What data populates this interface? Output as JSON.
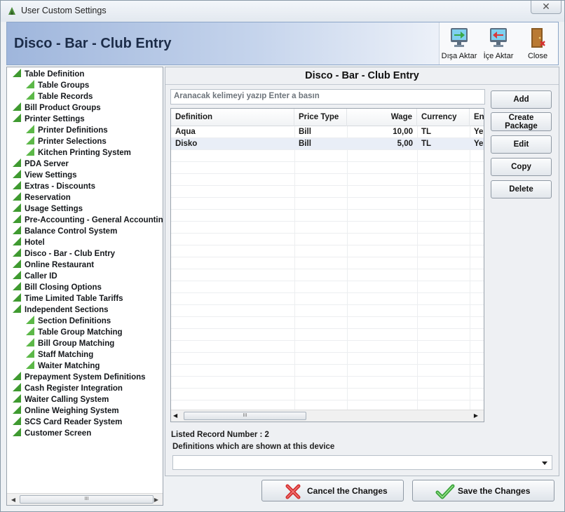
{
  "window": {
    "title": "User Custom Settings",
    "close_glyph": "✕"
  },
  "banner": {
    "title": "Disco - Bar - Club Entry"
  },
  "toolbar": [
    {
      "label": "Dışa Aktar",
      "icon": "export-monitor-icon"
    },
    {
      "label": "İçe Aktar",
      "icon": "import-monitor-icon"
    },
    {
      "label": "Close",
      "icon": "exit-door-icon"
    }
  ],
  "tree": {
    "items": [
      {
        "label": "Table Definition",
        "level": 0
      },
      {
        "label": "Table Groups",
        "level": 1
      },
      {
        "label": "Table Records",
        "level": 1
      },
      {
        "label": "Bill Product Groups",
        "level": 0
      },
      {
        "label": "Printer Settings",
        "level": 0
      },
      {
        "label": "Printer Definitions",
        "level": 1
      },
      {
        "label": "Printer Selections",
        "level": 1
      },
      {
        "label": "Kitchen Printing System",
        "level": 1
      },
      {
        "label": "PDA Server",
        "level": 0
      },
      {
        "label": "View Settings",
        "level": 0
      },
      {
        "label": "Extras - Discounts",
        "level": 0
      },
      {
        "label": "Reservation",
        "level": 0
      },
      {
        "label": "Usage Settings",
        "level": 0
      },
      {
        "label": "Pre-Accounting - General Accountin",
        "level": 0
      },
      {
        "label": "Balance Control System",
        "level": 0
      },
      {
        "label": "Hotel",
        "level": 0
      },
      {
        "label": "Disco - Bar - Club Entry",
        "level": 0
      },
      {
        "label": "Online Restaurant",
        "level": 0
      },
      {
        "label": "Caller ID",
        "level": 0
      },
      {
        "label": "Bill Closing Options",
        "level": 0
      },
      {
        "label": "Time Limited Table Tariffs",
        "level": 0
      },
      {
        "label": "Independent Sections",
        "level": 0
      },
      {
        "label": "Section Definitions",
        "level": 1
      },
      {
        "label": "Table Group Matching",
        "level": 1
      },
      {
        "label": "Bill Group Matching",
        "level": 1
      },
      {
        "label": "Staff Matching",
        "level": 1
      },
      {
        "label": "Waiter Matching",
        "level": 1
      },
      {
        "label": "Prepayment System Definitions",
        "level": 0
      },
      {
        "label": "Cash Register Integration",
        "level": 0
      },
      {
        "label": "Waiter Calling System",
        "level": 0
      },
      {
        "label": "Online Weighing System",
        "level": 0
      },
      {
        "label": "SCS Card Reader System",
        "level": 0
      },
      {
        "label": "Customer Screen",
        "level": 0
      }
    ]
  },
  "main": {
    "title": "Disco - Bar - Club Entry",
    "search_placeholder": "Aranacak kelimeyi yazıp Enter a basın",
    "columns": [
      "Definition",
      "Price Type",
      "Wage",
      "Currency",
      "En"
    ],
    "rows": [
      [
        "Aqua",
        "Bill",
        "10,00",
        "TL",
        "Ye"
      ],
      [
        "Disko",
        "Bill",
        "5,00",
        "TL",
        "Ye"
      ]
    ],
    "buttons": {
      "add": "Add",
      "create_package_1": "Create",
      "create_package_2": "Package",
      "edit": "Edit",
      "copy": "Copy",
      "delete": "Delete"
    },
    "record_count": "Listed Record Number : 2",
    "device_label": "Definitions which are shown at this device"
  },
  "footer": {
    "cancel": "Cancel the Changes",
    "save": "Save the Changes"
  },
  "scroll_glyphs": {
    "left": "◀",
    "right": "▶",
    "grip": "III"
  },
  "colors": {
    "tree_marker": "#3f9a30",
    "banner_start": "#9fb6dc",
    "selected_row": "#e9eef7"
  }
}
